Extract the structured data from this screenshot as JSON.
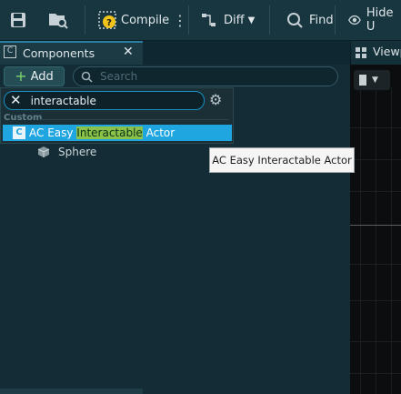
{
  "toolbar": {
    "compile_label": "Compile",
    "diff_label": "Diff",
    "find_label": "Find",
    "hide_label": "Hide U"
  },
  "components_tab": {
    "title": "Components"
  },
  "viewport_tab": {
    "title": "Viewp"
  },
  "add_button": {
    "label": "Add"
  },
  "search": {
    "placeholder": "Search"
  },
  "filter": {
    "value": "interactable"
  },
  "category": {
    "label": "Custom"
  },
  "result": {
    "prefix": "AC Easy ",
    "highlight": "Interactable",
    "suffix": " Actor"
  },
  "tree": {
    "child_label": "Sphere"
  },
  "tooltip": {
    "text": "AC Easy Interactable Actor"
  },
  "colors": {
    "accent": "#1fa5e0",
    "highlight": "#8bc34a",
    "panel": "#132c35",
    "compile_warning": "#f0c419"
  }
}
